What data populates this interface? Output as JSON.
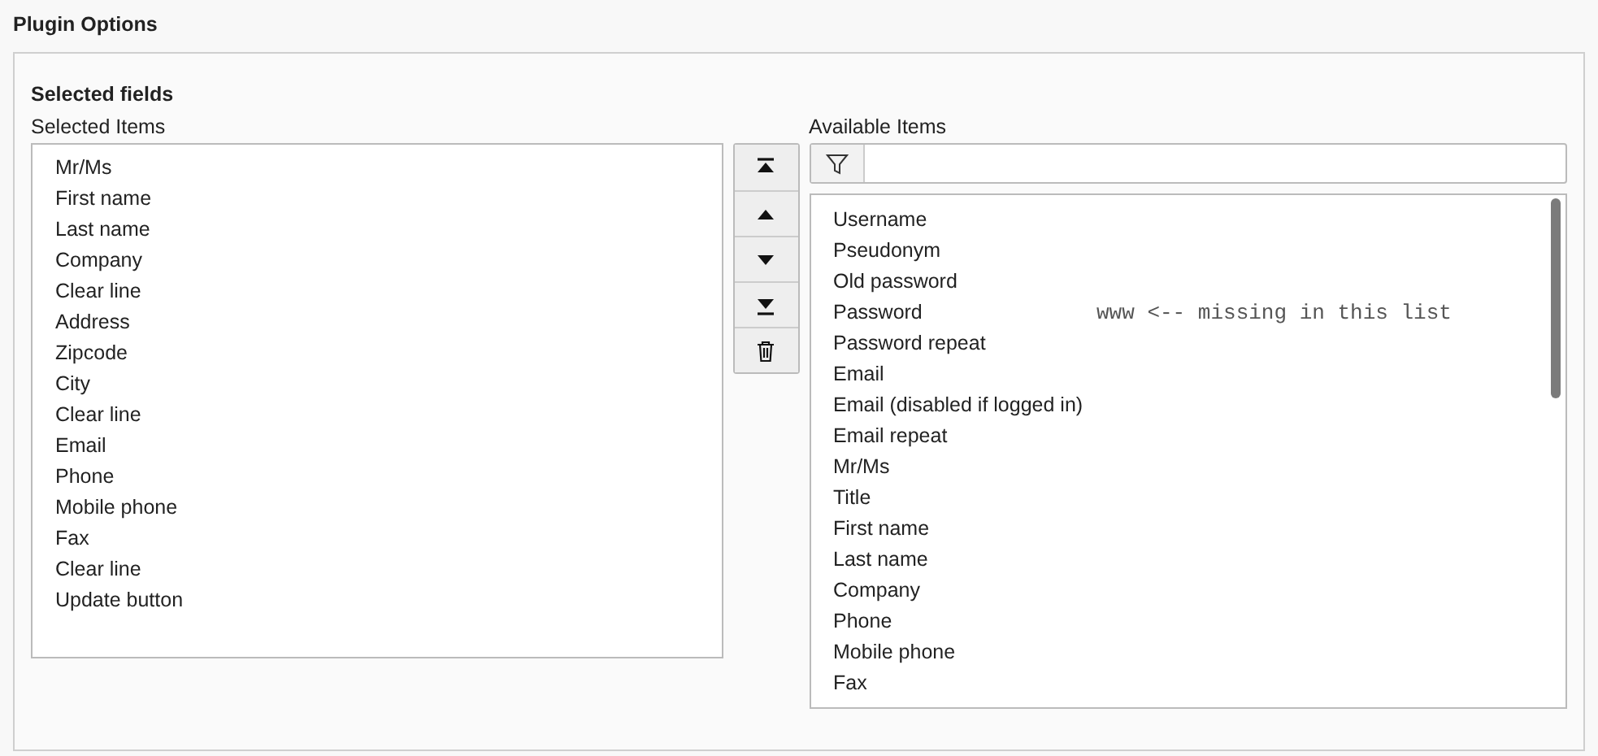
{
  "section_title": "Plugin Options",
  "panel": {
    "title": "Selected fields",
    "selected_list": {
      "label": "Selected Items",
      "items": [
        "Mr/Ms",
        "First name",
        "Last name",
        "Company",
        "Clear line",
        "Address",
        "Zipcode",
        "City",
        "Clear line",
        "Email",
        "Phone",
        "Mobile phone",
        "Fax",
        "Clear line",
        "Update button"
      ]
    },
    "buttons": [
      {
        "kind": "move-top"
      },
      {
        "kind": "move-up"
      },
      {
        "kind": "move-down"
      },
      {
        "kind": "move-bottom"
      },
      {
        "kind": "remove"
      }
    ],
    "available_list": {
      "label": "Available Items",
      "items": [
        {
          "text": "Username"
        },
        {
          "text": "Pseudonym"
        },
        {
          "text": "Old password"
        },
        {
          "text": "Password",
          "note": "www <-- missing in this list"
        },
        {
          "text": "Password repeat"
        },
        {
          "text": "Email"
        },
        {
          "text": "Email (disabled if logged in)"
        },
        {
          "text": "Email repeat"
        },
        {
          "text": "Mr/Ms"
        },
        {
          "text": "Title"
        },
        {
          "text": "First name"
        },
        {
          "text": "Last name"
        },
        {
          "text": "Company"
        },
        {
          "text": "Phone"
        },
        {
          "text": "Mobile phone"
        },
        {
          "text": "Fax"
        }
      ]
    }
  }
}
